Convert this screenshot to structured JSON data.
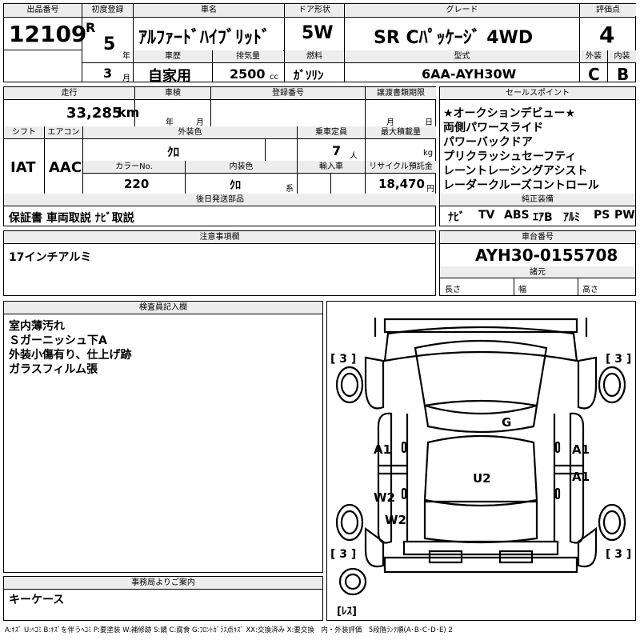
{
  "header": {
    "lot_label": "出品番号",
    "lot_no": "12109",
    "first_reg_label": "初度登録",
    "era": "R",
    "year": "5",
    "year_unit": "年",
    "month": "3",
    "month_unit": "月",
    "car_name_label": "車名",
    "car_name": "ｱﾙﾌｧｰﾄﾞﾊｲﾌﾞﾘｯﾄﾞ",
    "door_label": "ドア形状",
    "door": "5W",
    "grade_label": "グレード",
    "grade": "SR Cﾊﾟｯｹｰｼﾞ 4WD",
    "score_label": "評価点",
    "score": "4",
    "history_label": "車歴",
    "history": "自家用",
    "displacement_label": "排気量",
    "displacement": "2500",
    "displacement_unit": "cc",
    "fuel_label": "燃料",
    "fuel": "ｶﾞｿﾘﾝ",
    "model_label": "型式",
    "model": "6AA-AYH30W",
    "ext_grade_label": "外装",
    "ext_grade": "C",
    "int_grade_label": "内装",
    "int_grade": "B"
  },
  "row2": {
    "mileage_label": "走行",
    "mileage": "33,285",
    "mileage_unit": "km",
    "inspection_label": "車検",
    "insp_year": "年",
    "insp_month": "月",
    "regno_label": "登録番号",
    "transfer_label": "譲渡書類期限",
    "transfer_month": "月",
    "transfer_day": "日"
  },
  "row3": {
    "shift_label": "シフト",
    "shift": "IAT",
    "ac_label": "エアコン",
    "ac": "AAC",
    "ext_color_label": "外装色",
    "ext_color": "ｸﾛ",
    "capacity_label": "乗車定員",
    "capacity": "7",
    "capacity_unit": "人",
    "max_load_label": "最大積載量",
    "max_load_unit": "kg",
    "color_no_label": "カラーNo.",
    "color_no": "220",
    "int_color_label": "内装色",
    "int_color": "ｸﾛ",
    "int_color_unit": "系",
    "import_label": "輸入車",
    "recycle_label": "リサイクル預託金",
    "recycle": "18,470",
    "recycle_unit": "円"
  },
  "after_parts": {
    "label": "後日発送部品",
    "text": "保証書 車両取説 ﾅﾋﾞ取説"
  },
  "sales_points": {
    "label": "セールスポイント",
    "items": [
      "★オークションデビュー★",
      "両側パワースライド",
      "パワーバックドア",
      "プリクラッシュセーフティ",
      "レーントレーシングアシスト",
      "レーダークルーズコントロール"
    ]
  },
  "equipment": {
    "label": "純正装備",
    "items": [
      "ﾅﾋﾞ",
      "TV",
      "ABS",
      "ｴｱB",
      "ｱﾙﾐ",
      "PS",
      "PW"
    ]
  },
  "caution": {
    "label": "注意事項欄",
    "text": "17インチアルミ"
  },
  "chassis": {
    "label": "車台番号",
    "number": "AYH30-0155708"
  },
  "specs": {
    "label": "諸元",
    "length": "長さ",
    "width": "幅",
    "height": "高さ"
  },
  "inspector": {
    "label": "検査員記入欄",
    "lines": [
      "室内薄汚れ",
      "Ｓガーニッシュ下A",
      "外装小傷有り、仕上げ跡",
      "ガラスフィルム張"
    ]
  },
  "diagram_marks": {
    "g": "G",
    "a1_left": "A1",
    "a1_right_top": "A1",
    "a1_right_bottom": "A1",
    "w2_top": "W2",
    "w2_bottom": "W2",
    "u2": "U2",
    "tire_lf": "[ 3 ]",
    "tire_rf": "[ 3 ]",
    "tire_lr": "[ 3 ]",
    "tire_rr": "[ 3 ]",
    "spare": "[ﾚｽ]"
  },
  "office": {
    "label": "事務局よりご案内",
    "text": "キーケース"
  },
  "legend": "A:ｷｽﾞ U:ﾍｺﾐ B:ｷｽﾞを伴うﾍｺﾐ P:要塗装 W:補修跡 S:錆 C:腐食 G:ﾌﾛﾝﾄｶﾞﾗｽ点ｷｽﾞ XX:交換済み X:要交換　内・外装評価　5段階ﾗﾝｸ順(A･B･C･D･E) 2"
}
